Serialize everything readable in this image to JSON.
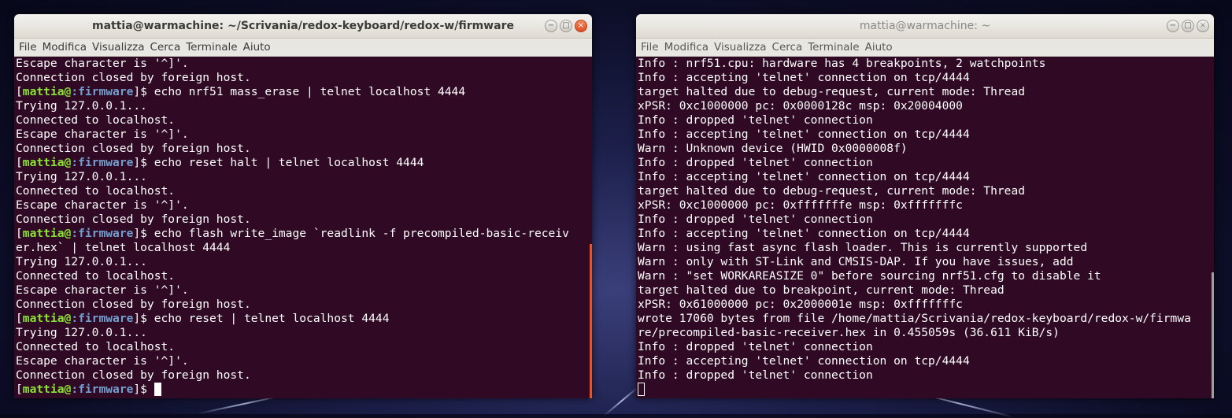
{
  "menu": [
    "File",
    "Modifica",
    "Visualizza",
    "Cerca",
    "Terminale",
    "Aiuto"
  ],
  "left_window": {
    "title": "mattia@warmachine: ~/Scrivania/redox-keyboard/redox-w/firmware",
    "prompt": {
      "user": "mattia@",
      "path": ":firmware",
      "suffix": "]$ "
    },
    "lines": [
      {
        "text": "Escape character is '^]'."
      },
      {
        "text": "Connection closed by foreign host."
      },
      {
        "prompt": true,
        "text": "echo nrf51 mass_erase | telnet localhost 4444"
      },
      {
        "text": "Trying 127.0.0.1..."
      },
      {
        "text": "Connected to localhost."
      },
      {
        "text": "Escape character is '^]'."
      },
      {
        "text": "Connection closed by foreign host."
      },
      {
        "prompt": true,
        "text": "echo reset halt | telnet localhost 4444"
      },
      {
        "text": "Trying 127.0.0.1..."
      },
      {
        "text": "Connected to localhost."
      },
      {
        "text": "Escape character is '^]'."
      },
      {
        "text": "Connection closed by foreign host."
      },
      {
        "prompt": true,
        "text": "echo flash write_image `readlink -f precompiled-basic-receiv"
      },
      {
        "text": "er.hex` | telnet localhost 4444"
      },
      {
        "text": "Trying 127.0.0.1..."
      },
      {
        "text": "Connected to localhost."
      },
      {
        "text": "Escape character is '^]'."
      },
      {
        "text": "Connection closed by foreign host."
      },
      {
        "prompt": true,
        "text": "echo reset | telnet localhost 4444"
      },
      {
        "text": "Trying 127.0.0.1..."
      },
      {
        "text": "Connected to localhost."
      },
      {
        "text": "Escape character is '^]'."
      },
      {
        "text": "Connection closed by foreign host."
      },
      {
        "prompt": true,
        "text": "",
        "cursor": true
      }
    ]
  },
  "right_window": {
    "title": "mattia@warmachine: ~",
    "lines": [
      "Info : nrf51.cpu: hardware has 4 breakpoints, 2 watchpoints",
      "Info : accepting 'telnet' connection on tcp/4444",
      "target halted due to debug-request, current mode: Thread",
      "xPSR: 0xc1000000 pc: 0x0000128c msp: 0x20004000",
      "Info : dropped 'telnet' connection",
      "Info : accepting 'telnet' connection on tcp/4444",
      "Warn : Unknown device (HWID 0x0000008f)",
      "Info : dropped 'telnet' connection",
      "Info : accepting 'telnet' connection on tcp/4444",
      "target halted due to debug-request, current mode: Thread",
      "xPSR: 0xc1000000 pc: 0xfffffffe msp: 0xfffffffc",
      "Info : dropped 'telnet' connection",
      "Info : accepting 'telnet' connection on tcp/4444",
      "Warn : using fast async flash loader. This is currently supported",
      "Warn : only with ST-Link and CMSIS-DAP. If you have issues, add",
      "Warn : \"set WORKAREASIZE 0\" before sourcing nrf51.cfg to disable it",
      "target halted due to breakpoint, current mode: Thread",
      "xPSR: 0x61000000 pc: 0x2000001e msp: 0xfffffffc",
      "wrote 17060 bytes from file /home/mattia/Scrivania/redox-keyboard/redox-w/firmwa",
      "re/precompiled-basic-receiver.hex in 0.455059s (36.611 KiB/s)",
      "Info : dropped 'telnet' connection",
      "Info : accepting 'telnet' connection on tcp/4444",
      "Info : dropped 'telnet' connection"
    ]
  },
  "window_controls": {
    "minimize": "−",
    "maximize": "□",
    "close": "×"
  },
  "colors": {
    "terminal_bg": "#300a24",
    "prompt_user": "#8ae234",
    "prompt_path": "#729fcf",
    "scrollbar_left": "#e95420",
    "scrollbar_right": "#9e9e9e"
  }
}
